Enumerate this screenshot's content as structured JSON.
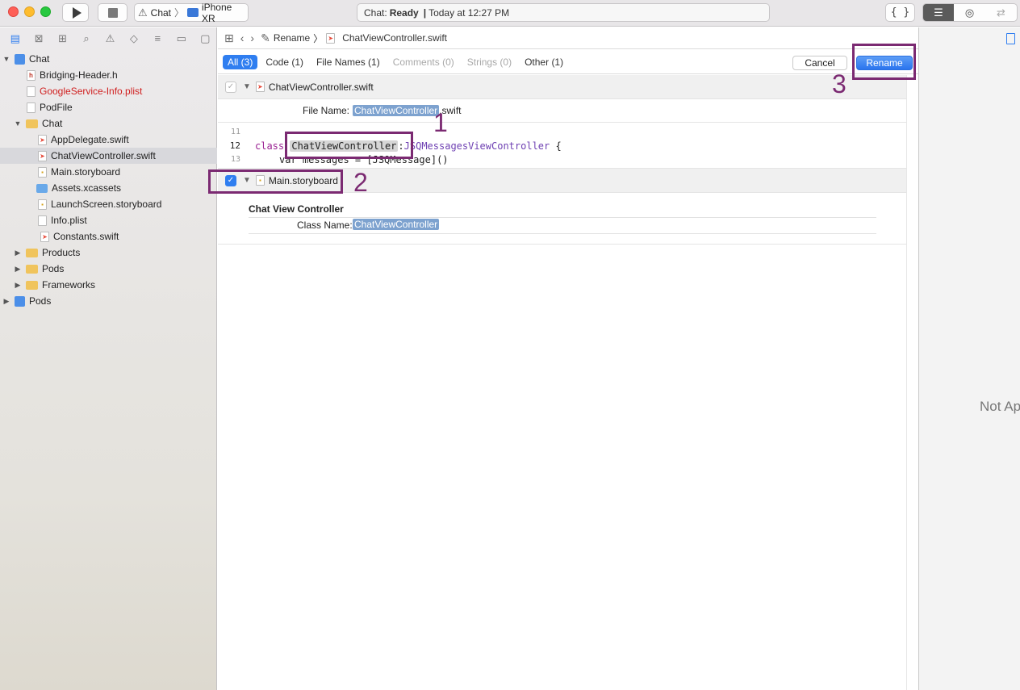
{
  "toolbar": {
    "scheme_app": "Chat",
    "scheme_device": "iPhone XR",
    "activity_app": "Chat:",
    "activity_status": "Ready",
    "activity_sep": "|",
    "activity_time": "Today at 12:27 PM",
    "braces_label": "{ }"
  },
  "navigator": {
    "items": [
      {
        "label": "Chat"
      },
      {
        "label": "Bridging-Header.h"
      },
      {
        "label": "GoogleService-Info.plist"
      },
      {
        "label": "PodFile"
      },
      {
        "label": "Chat"
      },
      {
        "label": "AppDelegate.swift"
      },
      {
        "label": "ChatViewController.swift"
      },
      {
        "label": "Main.storyboard"
      },
      {
        "label": "Assets.xcassets"
      },
      {
        "label": "LaunchScreen.storyboard"
      },
      {
        "label": "Info.plist"
      },
      {
        "label": "Constants.swift"
      },
      {
        "label": "Products"
      },
      {
        "label": "Pods"
      },
      {
        "label": "Frameworks"
      },
      {
        "label": "Pods"
      }
    ]
  },
  "jumpbar": {
    "rename": "Rename",
    "file": "ChatViewController.swift"
  },
  "filters": {
    "all": "All (3)",
    "code": "Code (1)",
    "file_names": "File Names (1)",
    "comments": "Comments (0)",
    "strings": "Strings (0)",
    "other": "Other (1)"
  },
  "actions": {
    "cancel": "Cancel",
    "rename": "Rename"
  },
  "results": {
    "file1": {
      "name": "ChatViewController.swift",
      "file_name_label": "File Name:",
      "file_name_highlight": "ChatViewController",
      "file_name_ext": ".swift"
    },
    "code": {
      "line11": "11",
      "line12": "12",
      "line13": "13",
      "kw_class": "class",
      "class_name": "ChatViewController",
      "colon": ":",
      "superclass": "JSQMessagesViewController",
      "brace": " {",
      "line13_text": "var messages = [JSQMessage]()"
    },
    "file2": {
      "name": "Main.storyboard",
      "section_title": "Chat View Controller",
      "class_name_label": "Class Name:",
      "class_name_value": "ChatViewController"
    }
  },
  "inspector": {
    "not_applicable": "Not Applicable"
  },
  "annotations": {
    "one": "1",
    "two": "2",
    "three": "3"
  },
  "colors": {
    "annotation": "#7b2a72",
    "accent": "#2f7ef0",
    "highlight": "#7da2cf"
  }
}
